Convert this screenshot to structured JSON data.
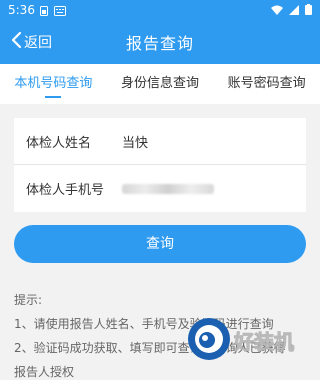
{
  "status": {
    "time": "5:36"
  },
  "nav": {
    "back_label": "返回",
    "title": "报告查询"
  },
  "tabs": [
    {
      "label": "本机号码查询",
      "active": true
    },
    {
      "label": "身份信息查询",
      "active": false
    },
    {
      "label": "账号密码查询",
      "active": false
    }
  ],
  "form": {
    "name_label": "体检人姓名",
    "name_value": "当快",
    "phone_label": "体检人手机号"
  },
  "query_button": "查询",
  "tips": {
    "title": "提示:",
    "items": [
      "1、请使用报告人姓名、手机号及验证码进行查询",
      "2、验证码成功获取、填写即可查询，查询人已获得",
      "报告人授权"
    ]
  },
  "watermark": {
    "text": "好装机"
  },
  "colors": {
    "accent": "#2e9bf0",
    "background": "#f2f2f2"
  }
}
